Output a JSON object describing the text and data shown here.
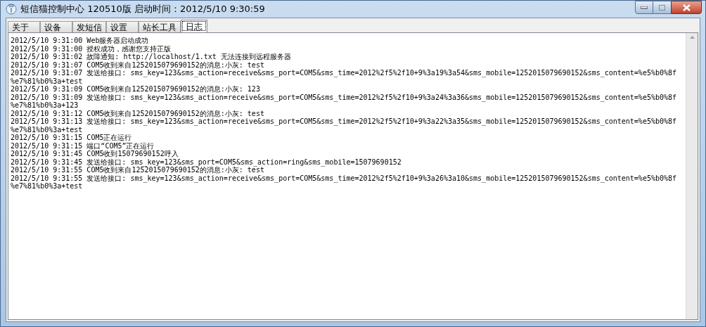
{
  "window": {
    "title": "短信猫控制中心 120510版 启动时间：2012/5/10 9:30:59"
  },
  "tabs": [
    {
      "label": "关于",
      "selected": false
    },
    {
      "label": "设备",
      "selected": false
    },
    {
      "label": "发短信",
      "selected": false
    },
    {
      "label": "设置",
      "selected": false
    },
    {
      "label": "站长工具",
      "selected": false
    },
    {
      "label": "日志",
      "selected": true
    }
  ],
  "log_lines": [
    "2012/5/10 9:31:00 Web服务器启动成功",
    "2012/5/10 9:31:00 授权成功，感谢您支持正版",
    "2012/5/10 9:31:02 故障通知: http://localhost/1.txt 无法连接到远程服务器",
    "2012/5/10 9:31:07 COM5收到来自1252015079690152的消息:小灰: test",
    "2012/5/10 9:31:07 发送给接口: sms_key=123&sms_action=receive&sms_port=COM5&sms_time=2012%2f5%2f10+9%3a19%3a54&sms_mobile=1252015079690152&sms_content=%e5%b0%8f",
    "%e7%81%b0%3a+test",
    "2012/5/10 9:31:09 COM5收到来自1252015079690152的消息:小灰: 123",
    "2012/5/10 9:31:09 发送给接口: sms_key=123&sms_action=receive&sms_port=COM5&sms_time=2012%2f5%2f10+9%3a24%3a36&sms_mobile=1252015079690152&sms_content=%e5%b0%8f",
    "%e7%81%b0%3a+123",
    "2012/5/10 9:31:12 COM5收到来自1252015079690152的消息:小灰: test",
    "2012/5/10 9:31:13 发送给接口: sms_key=123&sms_action=receive&sms_port=COM5&sms_time=2012%2f5%2f10+9%3a22%3a35&sms_mobile=1252015079690152&sms_content=%e5%b0%8f",
    "%e7%81%b0%3a+test",
    "2012/5/10 9:31:15 COM5正在运行",
    "2012/5/10 9:31:15 端口“COM5”正在运行",
    "2012/5/10 9:31:45 COM5收到15079690152呼入",
    "2012/5/10 9:31:45 发送给接口: sms_key=123&sms_port=COM5&sms_action=ring&sms_mobile=15079690152",
    "2012/5/10 9:31:55 COM5收到来自1252015079690152的消息:小灰: test",
    "2012/5/10 9:31:55 发送给接口: sms_key=123&sms_action=receive&sms_port=COM5&sms_time=2012%2f5%2f10+9%3a26%3a10&sms_mobile=1252015079690152&sms_content=%e5%b0%8f",
    "%e7%81%b0%3a+test"
  ]
}
